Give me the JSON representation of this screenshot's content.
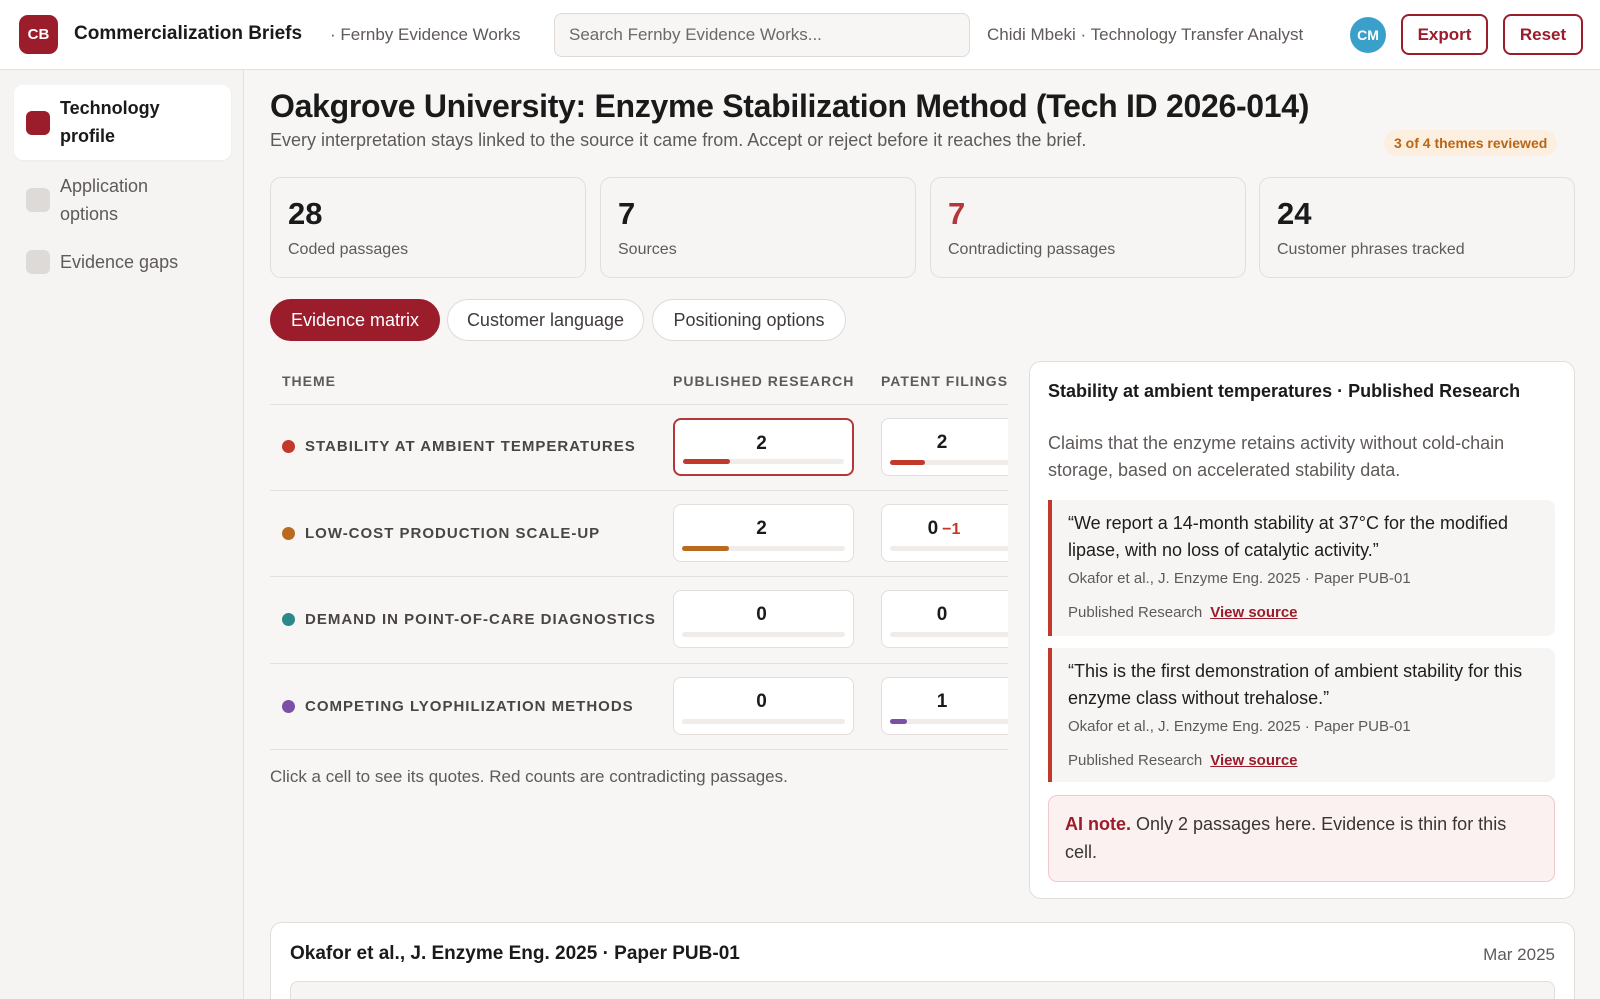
{
  "header": {
    "logo": "CB",
    "app_title": "Commercialization Briefs",
    "org": "· Fernby Evidence Works",
    "search_placeholder": "Search Fernby Evidence Works...",
    "user": "Chidi Mbeki · Technology Transfer Analyst",
    "avatar": "CM",
    "export_label": "Export",
    "reset_label": "Reset"
  },
  "sidebar": {
    "items": [
      {
        "label": "Technology profile",
        "active": true
      },
      {
        "label": "Application options",
        "active": false
      },
      {
        "label": "Evidence gaps",
        "active": false
      }
    ]
  },
  "page": {
    "title": "Oakgrove University: Enzyme Stabilization Method (Tech ID 2026-014)",
    "subtitle": "Every interpretation stays linked to the source it came from. Accept or reject before it reaches the brief.",
    "review_badge": "3 of 4 themes reviewed"
  },
  "stats": [
    {
      "value": "28",
      "label": "Coded passages"
    },
    {
      "value": "7",
      "label": "Sources"
    },
    {
      "value": "7",
      "label": "Contradicting passages"
    },
    {
      "value": "24",
      "label": "Customer phrases tracked"
    }
  ],
  "tabs": [
    {
      "label": "Evidence matrix",
      "active": true
    },
    {
      "label": "Customer language",
      "active": false
    },
    {
      "label": "Positioning options",
      "active": false
    }
  ],
  "matrix": {
    "columns": [
      "THEME",
      "PUBLISHED RESEARCH",
      "PATENT FILINGS"
    ],
    "rows": [
      {
        "theme": "STABILITY AT AMBIENT TEMPERATURES",
        "color": "#c0392b",
        "cells": [
          {
            "count": "2",
            "contra": "",
            "fill": 0.29,
            "selected": true
          },
          {
            "count": "2",
            "contra": "",
            "fill": 0.29,
            "selected": false
          }
        ]
      },
      {
        "theme": "LOW-COST PRODUCTION SCALE-UP",
        "color": "#b96a1f",
        "cells": [
          {
            "count": "2",
            "contra": "",
            "fill": 0.29,
            "selected": false
          },
          {
            "count": "0",
            "contra": "−1",
            "fill": 0,
            "selected": false
          }
        ]
      },
      {
        "theme": "DEMAND IN POINT-OF-CARE DIAGNOSTICS",
        "color": "#2a8a8a",
        "cells": [
          {
            "count": "0",
            "contra": "",
            "fill": 0,
            "selected": false
          },
          {
            "count": "0",
            "contra": "",
            "fill": 0,
            "selected": false
          }
        ]
      },
      {
        "theme": "COMPETING LYOPHILIZATION METHODS",
        "color": "#7b4fa6",
        "cells": [
          {
            "count": "0",
            "contra": "",
            "fill": 0,
            "selected": false
          },
          {
            "count": "1",
            "contra": "",
            "fill": 0.14,
            "selected": false
          }
        ]
      }
    ],
    "hint": "Click a cell to see its quotes. Red counts are contradicting passages."
  },
  "detail": {
    "title": "Stability at ambient temperatures · Published Research",
    "description": "Claims that the enzyme retains activity without cold-chain storage, based on accelerated stability data.",
    "quotes": [
      {
        "text": "“We report a 14-month stability at 37°C for the modified lipase, with no loss of catalytic activity.”",
        "citation": "Okafor et al., J. Enzyme Eng. 2025 · Paper PUB-01",
        "source_type": "Published Research",
        "link": "View source"
      },
      {
        "text": "“This is the first demonstration of ambient stability for this enzyme class without trehalose.”",
        "citation": "Okafor et al., J. Enzyme Eng. 2025 · Paper PUB-01",
        "source_type": "Published Research",
        "link": "View source"
      }
    ],
    "ai_note_label": "AI note.",
    "ai_note_text": " Only 2 passages here. Evidence is thin for this cell."
  },
  "source_card": {
    "title": "Okafor et al., J. Enzyme Eng. 2025 · Paper PUB-01",
    "date": "Mar 2025"
  }
}
